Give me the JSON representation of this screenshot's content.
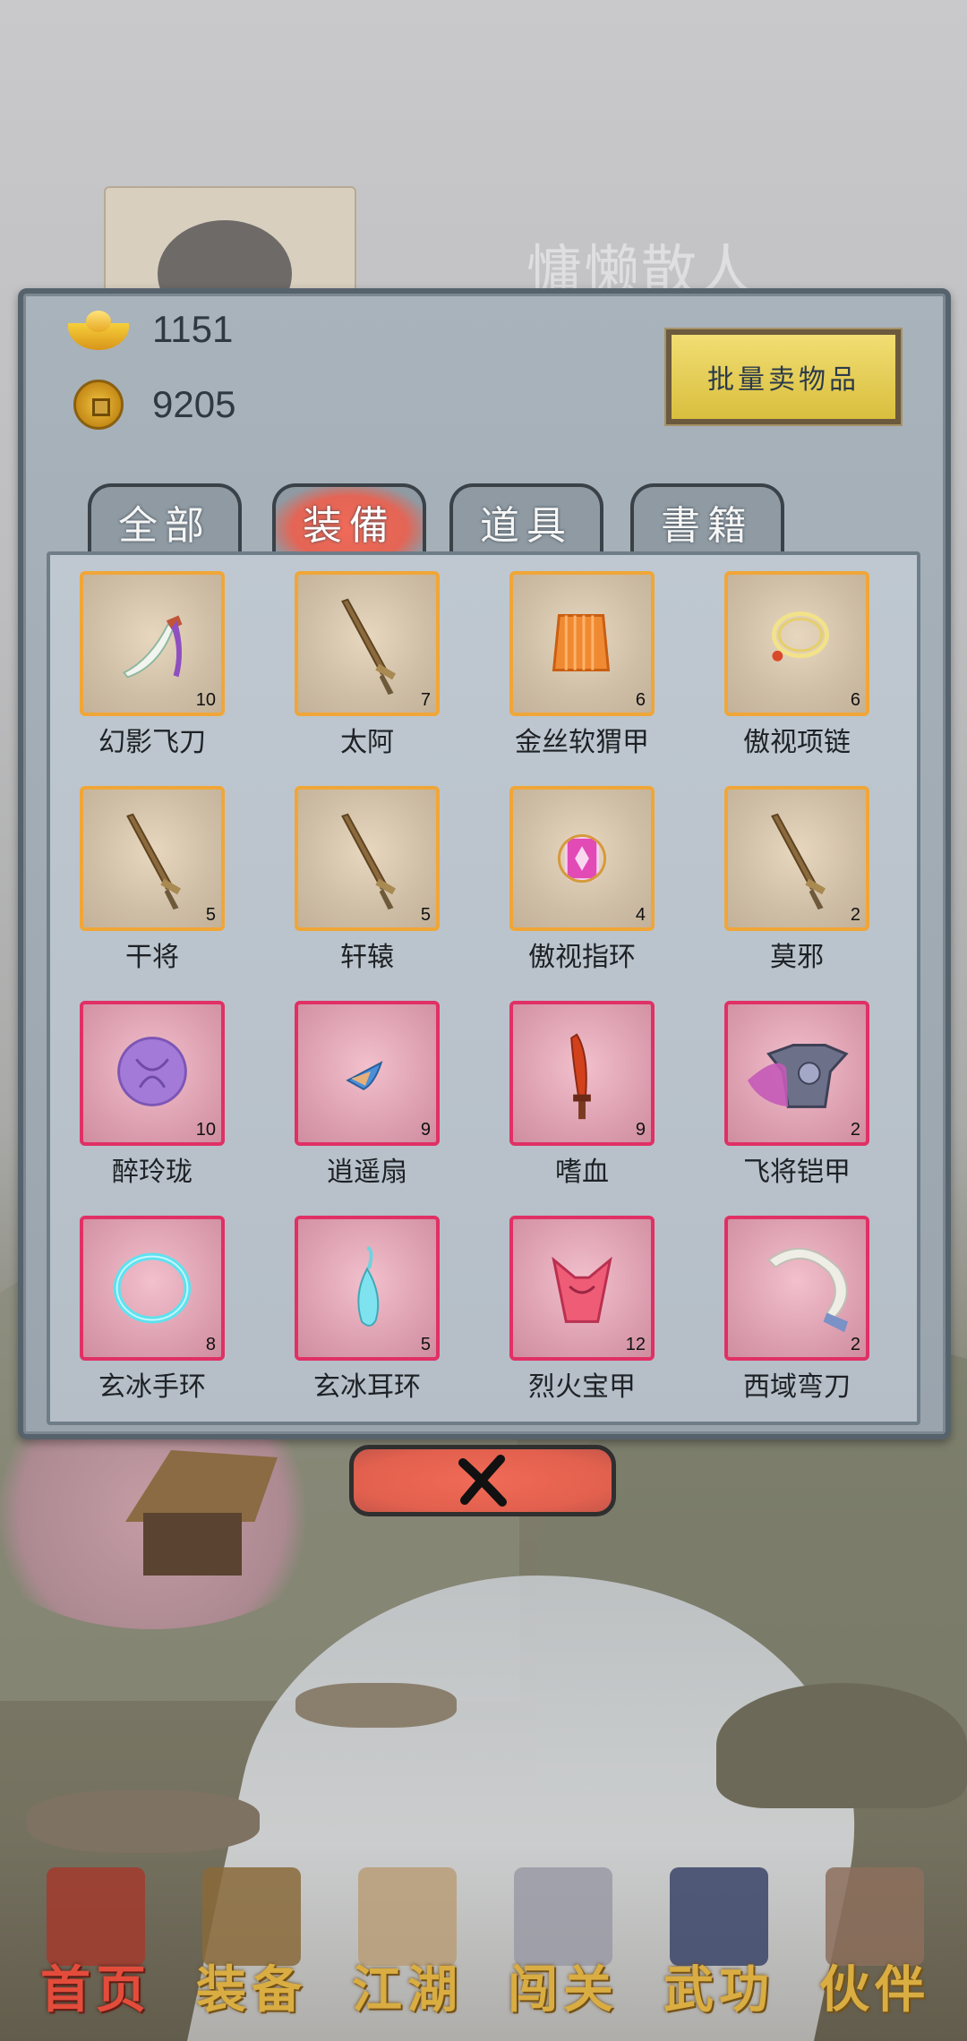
{
  "player": {
    "name": "慵懒散人"
  },
  "currency": {
    "gold": "1151",
    "coins": "9205"
  },
  "sell_button": "批量卖物品",
  "tabs": [
    {
      "label": "全部",
      "active": false
    },
    {
      "label": "装備",
      "active": true
    },
    {
      "label": "道具",
      "active": false
    },
    {
      "label": "書籍",
      "active": false
    }
  ],
  "items": [
    {
      "name": "幻影飞刀",
      "count": "10",
      "rarity": "orange",
      "icon": "flying-dagger-icon"
    },
    {
      "name": "太阿",
      "count": "7",
      "rarity": "orange",
      "icon": "sword-icon"
    },
    {
      "name": "金丝软猬甲",
      "count": "6",
      "rarity": "orange",
      "icon": "vest-armor-icon"
    },
    {
      "name": "傲视项链",
      "count": "6",
      "rarity": "orange",
      "icon": "necklace-icon"
    },
    {
      "name": "干将",
      "count": "5",
      "rarity": "orange",
      "icon": "sword-icon"
    },
    {
      "name": "轩辕",
      "count": "5",
      "rarity": "orange",
      "icon": "sword-icon"
    },
    {
      "name": "傲视指环",
      "count": "4",
      "rarity": "orange",
      "icon": "ring-icon"
    },
    {
      "name": "莫邪",
      "count": "2",
      "rarity": "orange",
      "icon": "sword-icon"
    },
    {
      "name": "醉玲珑",
      "count": "10",
      "rarity": "pink",
      "icon": "jade-disc-icon"
    },
    {
      "name": "逍遥扇",
      "count": "9",
      "rarity": "pink",
      "icon": "fan-icon"
    },
    {
      "name": "嗜血",
      "count": "9",
      "rarity": "pink",
      "icon": "blood-blade-icon"
    },
    {
      "name": "飞将铠甲",
      "count": "2",
      "rarity": "pink",
      "icon": "shoulder-armor-icon"
    },
    {
      "name": "玄冰手环",
      "count": "8",
      "rarity": "pink",
      "icon": "bracelet-icon"
    },
    {
      "name": "玄冰耳环",
      "count": "5",
      "rarity": "pink",
      "icon": "earring-icon"
    },
    {
      "name": "烈火宝甲",
      "count": "12",
      "rarity": "pink",
      "icon": "fire-armor-icon"
    },
    {
      "name": "西域弯刀",
      "count": "2",
      "rarity": "pink",
      "icon": "scimitar-icon"
    }
  ],
  "close_icon": "close-icon",
  "nav": [
    {
      "label": "首页",
      "icon": "house-icon",
      "active": true
    },
    {
      "label": "装备",
      "icon": "armor-icon",
      "active": false
    },
    {
      "label": "江湖",
      "icon": "scroll-icon",
      "active": false
    },
    {
      "label": "闯关",
      "icon": "crossed-swords-icon",
      "active": false
    },
    {
      "label": "武功",
      "icon": "book-icon",
      "active": false
    },
    {
      "label": "伙伴",
      "icon": "partners-icon",
      "active": false
    }
  ],
  "colors": {
    "rarity_orange": "#f0a637",
    "rarity_pink": "#e03065",
    "tab_active": "#e46555",
    "sell_button": "#e8d35c",
    "nav_label": "#d9ad42",
    "nav_label_active": "#e34c3b"
  }
}
